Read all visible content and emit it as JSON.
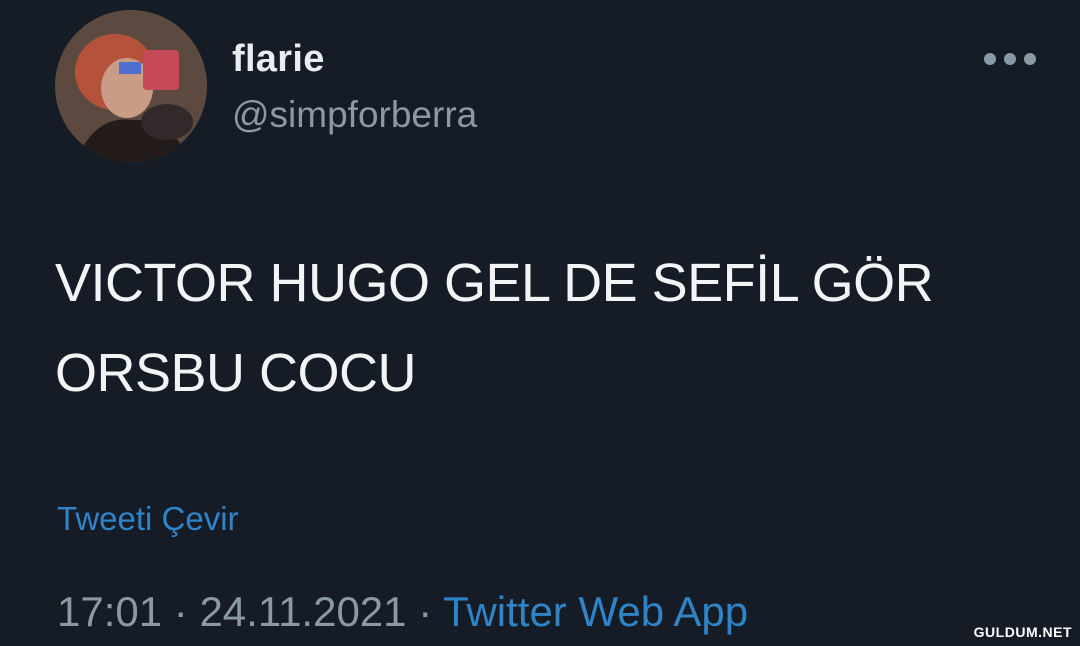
{
  "user": {
    "display_name": "flarie",
    "handle": "@simpforberra",
    "avatar_icon": "profile-photo"
  },
  "menu": {
    "icon": "more-icon"
  },
  "tweet": {
    "text": "VICTOR HUGO GEL DE SEFİL GÖR\nORSBU COCU",
    "translate_label": "Tweeti Çevir"
  },
  "meta": {
    "time": "17:01",
    "separator": "·",
    "date": "24.11.2021",
    "source": "Twitter Web App"
  },
  "watermark": {
    "text": "GULDUM.NET"
  },
  "colors": {
    "background": "#151c26",
    "link": "#2f84c8",
    "muted": "#8b98a5",
    "text": "#f2f4f6"
  }
}
